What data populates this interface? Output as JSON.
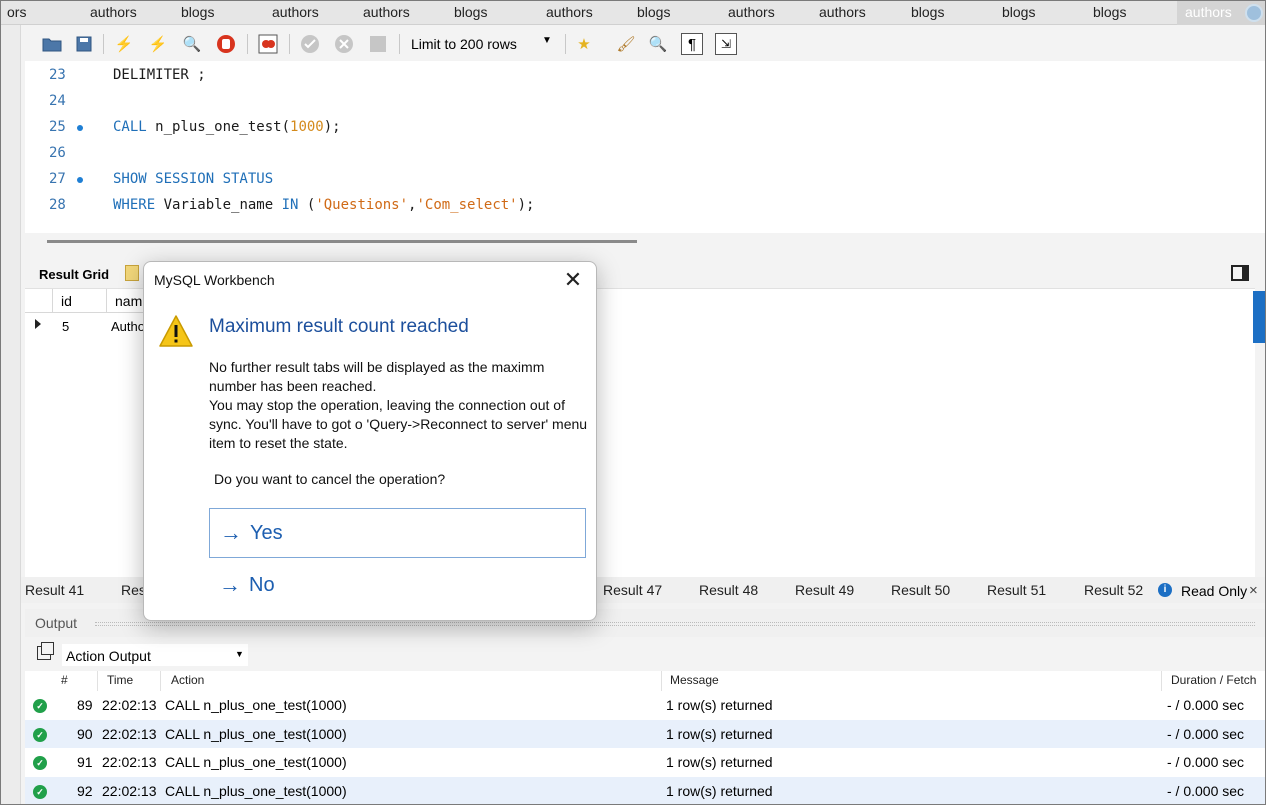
{
  "tabs": [
    "ors",
    "authors",
    "blogs",
    "authors",
    "authors",
    "blogs",
    "authors",
    "blogs",
    "authors",
    "authors",
    "blogs",
    "blogs",
    "blogs"
  ],
  "active_tab": "authors",
  "toolbar": {
    "limit": "Limit to 200 rows",
    "icons": [
      "open-folder-icon",
      "save-icon",
      "execute-icon",
      "execute-current-icon",
      "explain-icon",
      "stop-icon",
      "toggle-continue-icon",
      "commit-icon",
      "rollback-icon",
      "autocommit-icon",
      "add-snippet-icon",
      "beautify-icon",
      "find-icon",
      "invisible-chars-icon",
      "wrap-icon"
    ]
  },
  "editor": {
    "lines": [
      {
        "num": "23",
        "code": "DELIMITER ;",
        "marker": false
      },
      {
        "num": "24",
        "code": "",
        "marker": false
      },
      {
        "num": "25",
        "code": "CALL n_plus_one_test(1000);",
        "marker": true
      },
      {
        "num": "26",
        "code": "",
        "marker": false
      },
      {
        "num": "27",
        "code": "SHOW SESSION STATUS",
        "marker": true
      },
      {
        "num": "28",
        "code": "WHERE Variable_name IN ('Questions','Com_select');",
        "marker": false
      }
    ]
  },
  "result": {
    "grid_label": "Result Grid",
    "columns": [
      "id",
      "nam"
    ],
    "rows": [
      [
        "5",
        "Autho"
      ]
    ]
  },
  "result_tabs": [
    "Result 41",
    "Res",
    "Result 47",
    "Result 48",
    "Result 49",
    "Result 50",
    "Result 51",
    "Result 52"
  ],
  "read_only": "Read Only",
  "output": {
    "label": "Output",
    "selector": "Action Output",
    "columns": {
      "num": "#",
      "time": "Time",
      "action": "Action",
      "message": "Message",
      "duration": "Duration / Fetch"
    },
    "rows": [
      {
        "num": "89",
        "time": "22:02:13",
        "action": "CALL n_plus_one_test(1000)",
        "message": "1 row(s) returned",
        "duration": "- / 0.000 sec"
      },
      {
        "num": "90",
        "time": "22:02:13",
        "action": "CALL n_plus_one_test(1000)",
        "message": "1 row(s) returned",
        "duration": "- / 0.000 sec"
      },
      {
        "num": "91",
        "time": "22:02:13",
        "action": "CALL n_plus_one_test(1000)",
        "message": "1 row(s) returned",
        "duration": "- / 0.000 sec"
      },
      {
        "num": "92",
        "time": "22:02:13",
        "action": "CALL n_plus_one_test(1000)",
        "message": "1 row(s) returned",
        "duration": "- / 0.000 sec"
      }
    ]
  },
  "dialog": {
    "title": "MySQL Workbench",
    "heading": "Maximum result count reached",
    "body_1": "No further result tabs will be displayed as the maximm number has been reached.",
    "body_2": "You may stop the operation, leaving the connection out of sync. You'll have to got o 'Query->Reconnect to server' menu item to reset the state.",
    "question": "Do you want to cancel the operation?",
    "yes": "Yes",
    "no": "No"
  },
  "colors": {
    "accent": "#1c5eb0",
    "heading": "#1c4f9c",
    "success": "#21a04a",
    "keyword": "#1f6fb8",
    "string": "#d06a16"
  }
}
